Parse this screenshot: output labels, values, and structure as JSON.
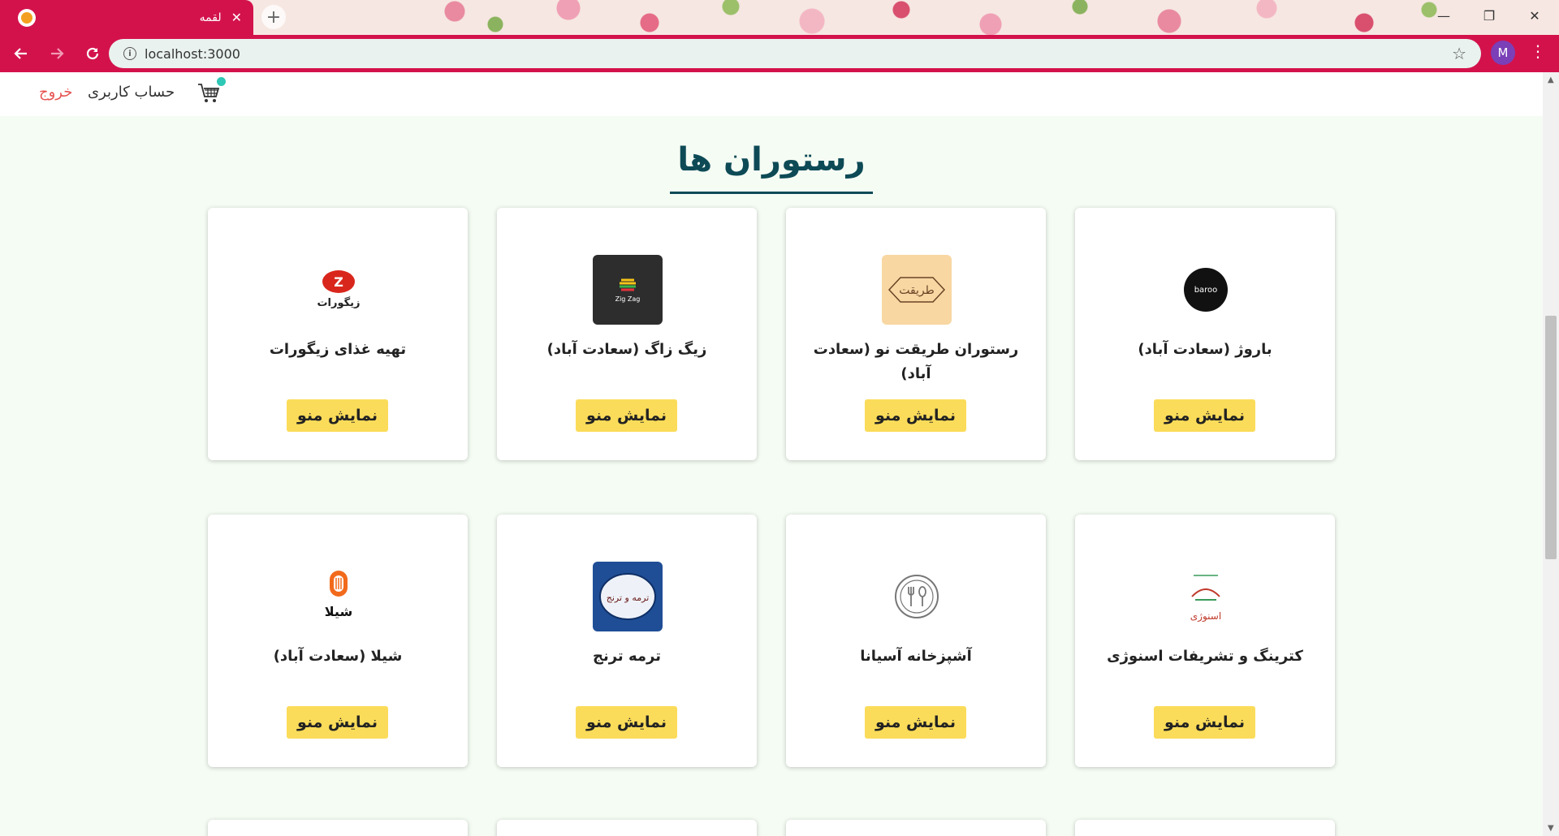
{
  "browser": {
    "tab_title": "لقمه",
    "url": "localhost:3000",
    "profile_initial": "M"
  },
  "header": {
    "logout": "خروج",
    "account": "حساب کاربری"
  },
  "main": {
    "title": "رستوران ها",
    "cards": [
      {
        "name": "باروژ (سعادت آباد)",
        "logo_label": "baroo",
        "button": "نمایش منو"
      },
      {
        "name": "رستوران طریقت نو (سعادت آباد)",
        "logo_label": "طریقت",
        "button": "نمایش منو"
      },
      {
        "name": "زیگ زاگ (سعادت آباد)",
        "logo_label": "Zig Zag",
        "button": "نمایش منو"
      },
      {
        "name": "تهیه غذای زیگورات",
        "logo_label": "زیگورات",
        "button": "نمایش منو"
      },
      {
        "name": "کترینگ و تشریفات اسنوژی",
        "logo_label": "اسنوژی",
        "button": "نمایش منو"
      },
      {
        "name": "آشپزخانه آسیانا",
        "logo_label": "",
        "button": "نمایش منو"
      },
      {
        "name": "ترمه ترنج",
        "logo_label": "ترمه و ترنج",
        "button": "نمایش منو"
      },
      {
        "name": "شیلا (سعادت آباد)",
        "logo_label": "شیلا",
        "button": "نمایش منو"
      }
    ]
  },
  "colors": {
    "browser_accent": "#d3124c",
    "title": "#0d4a56",
    "button": "#fbdc5a",
    "logout": "#e55351",
    "page_bg": "#f5fcf4"
  }
}
